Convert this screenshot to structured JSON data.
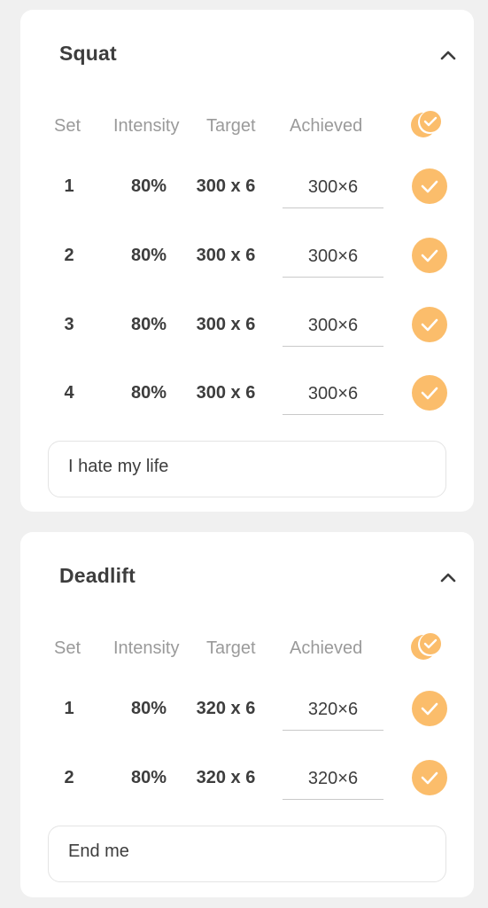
{
  "columns": {
    "set": "Set",
    "intensity": "Intensity",
    "target": "Target",
    "achieved": "Achieved"
  },
  "colors": {
    "accent": "#fbbd6b",
    "text": "#3d3d3d",
    "muted": "#9a9a9a",
    "background": "#f0f0f0",
    "card": "#ffffff"
  },
  "icons": {
    "collapse": "chevron-up-icon",
    "complete_all": "double-check-icon",
    "complete_set": "check-icon"
  },
  "exercises": [
    {
      "name": "Squat",
      "expanded": true,
      "sets": [
        {
          "set": "1",
          "intensity": "80%",
          "target": "300 x 6",
          "achieved": "300×6",
          "done": true
        },
        {
          "set": "2",
          "intensity": "80%",
          "target": "300 x 6",
          "achieved": "300×6",
          "done": true
        },
        {
          "set": "3",
          "intensity": "80%",
          "target": "300 x 6",
          "achieved": "300×6",
          "done": true
        },
        {
          "set": "4",
          "intensity": "80%",
          "target": "300 x 6",
          "achieved": "300×6",
          "done": true
        }
      ],
      "note": "I hate my life"
    },
    {
      "name": "Deadlift",
      "expanded": true,
      "sets": [
        {
          "set": "1",
          "intensity": "80%",
          "target": "320 x 6",
          "achieved": "320×6",
          "done": true
        },
        {
          "set": "2",
          "intensity": "80%",
          "target": "320 x 6",
          "achieved": "320×6",
          "done": true
        }
      ],
      "note": "End me"
    }
  ]
}
